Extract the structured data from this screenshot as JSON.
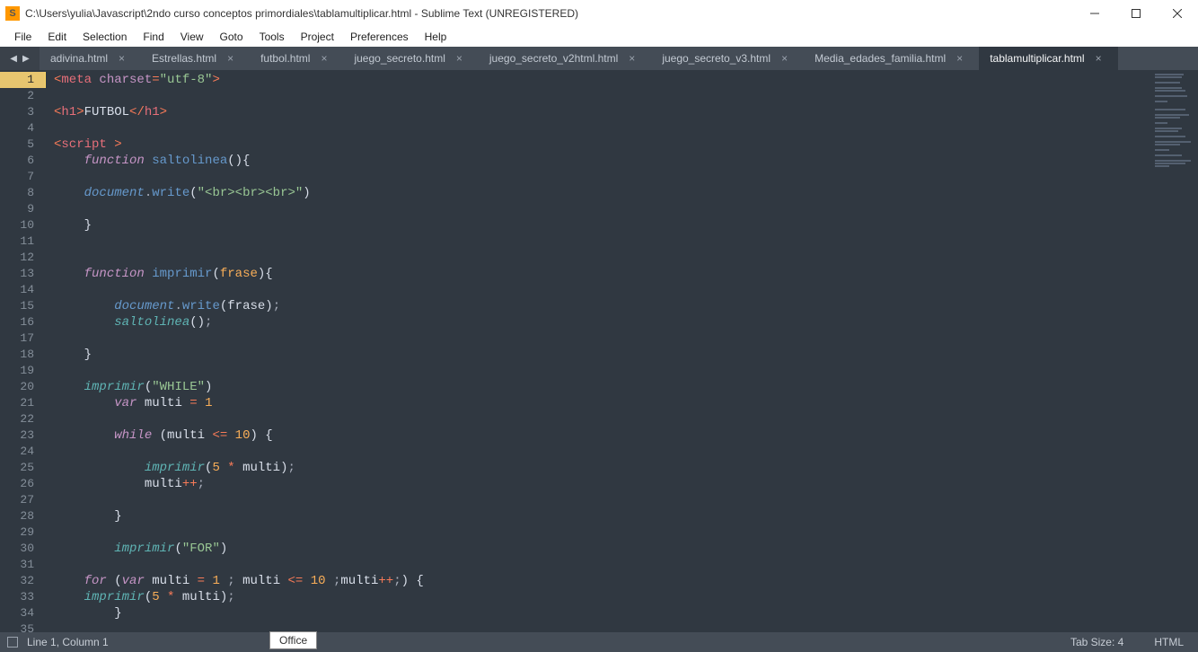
{
  "window": {
    "title": "C:\\Users\\yulia\\Javascript\\2ndo curso conceptos primordiales\\tablamultiplicar.html - Sublime Text (UNREGISTERED)",
    "logo": "S"
  },
  "menu": [
    "File",
    "Edit",
    "Selection",
    "Find",
    "View",
    "Goto",
    "Tools",
    "Project",
    "Preferences",
    "Help"
  ],
  "tabs": [
    {
      "label": "adivina.html",
      "active": false
    },
    {
      "label": "Estrellas.html",
      "active": false
    },
    {
      "label": "futbol.html",
      "active": false
    },
    {
      "label": "juego_secreto.html",
      "active": false
    },
    {
      "label": "juego_secreto_v2html.html",
      "active": false
    },
    {
      "label": "juego_secreto_v3.html",
      "active": false
    },
    {
      "label": "Media_edades_familia.html",
      "active": false
    },
    {
      "label": "tablamultiplicar.html",
      "active": true
    }
  ],
  "status": {
    "cursor": "Line 1, Column 1",
    "chip": "Office",
    "tabsize": "Tab Size: 4",
    "syntax": "HTML"
  },
  "editor": {
    "line_count": 35,
    "current_line": 1
  },
  "code_lines": [
    {
      "tokens": [
        [
          "<",
          "c-op"
        ],
        [
          "meta",
          "c-tag"
        ],
        [
          " ",
          "c-text"
        ],
        [
          "charset",
          "c-attr"
        ],
        [
          "=",
          "c-op"
        ],
        [
          "\"utf-8\"",
          "c-str"
        ],
        [
          ">",
          "c-op"
        ]
      ]
    },
    {
      "tokens": []
    },
    {
      "tokens": [
        [
          "<",
          "c-op"
        ],
        [
          "h1",
          "c-tag"
        ],
        [
          ">",
          "c-op"
        ],
        [
          "FUTBOL",
          "c-text"
        ],
        [
          "</",
          "c-op"
        ],
        [
          "h1",
          "c-tag"
        ],
        [
          ">",
          "c-op"
        ]
      ]
    },
    {
      "tokens": []
    },
    {
      "tokens": [
        [
          "<",
          "c-op"
        ],
        [
          "script",
          "c-tag"
        ],
        [
          " >",
          "c-op"
        ]
      ]
    },
    {
      "tokens": [
        [
          "    ",
          "c-text"
        ],
        [
          "function",
          "c-kw"
        ],
        [
          " ",
          "c-text"
        ],
        [
          "saltolinea",
          "c-fn"
        ],
        [
          "(){",
          "c-text"
        ]
      ]
    },
    {
      "tokens": []
    },
    {
      "tokens": [
        [
          "    ",
          "c-text"
        ],
        [
          "document",
          "c-obj"
        ],
        [
          ".",
          "c-punc"
        ],
        [
          "write",
          "c-fn"
        ],
        [
          "(",
          "c-text"
        ],
        [
          "\"<br><br><br>\"",
          "c-str"
        ],
        [
          ")",
          "c-text"
        ]
      ]
    },
    {
      "tokens": []
    },
    {
      "tokens": [
        [
          "    }",
          "c-text"
        ]
      ]
    },
    {
      "tokens": []
    },
    {
      "tokens": []
    },
    {
      "tokens": [
        [
          "    ",
          "c-text"
        ],
        [
          "function",
          "c-kw"
        ],
        [
          " ",
          "c-text"
        ],
        [
          "imprimir",
          "c-fn"
        ],
        [
          "(",
          "c-text"
        ],
        [
          "frase",
          "c-param"
        ],
        [
          "){",
          "c-text"
        ]
      ]
    },
    {
      "tokens": []
    },
    {
      "tokens": [
        [
          "        ",
          "c-text"
        ],
        [
          "document",
          "c-obj"
        ],
        [
          ".",
          "c-punc"
        ],
        [
          "write",
          "c-fn"
        ],
        [
          "(",
          "c-text"
        ],
        [
          "frase",
          "c-var"
        ],
        [
          ")",
          "c-text"
        ],
        [
          ";",
          "c-punc"
        ]
      ]
    },
    {
      "tokens": [
        [
          "        ",
          "c-text"
        ],
        [
          "saltolinea",
          "c-fn-i"
        ],
        [
          "()",
          "c-text"
        ],
        [
          ";",
          "c-punc"
        ]
      ]
    },
    {
      "tokens": []
    },
    {
      "tokens": [
        [
          "    }",
          "c-text"
        ]
      ]
    },
    {
      "tokens": []
    },
    {
      "tokens": [
        [
          "    ",
          "c-text"
        ],
        [
          "imprimir",
          "c-fn-i"
        ],
        [
          "(",
          "c-text"
        ],
        [
          "\"WHILE\"",
          "c-str"
        ],
        [
          ")",
          "c-text"
        ]
      ]
    },
    {
      "tokens": [
        [
          "        ",
          "c-text"
        ],
        [
          "var",
          "c-kw"
        ],
        [
          " multi ",
          "c-text"
        ],
        [
          "=",
          "c-op"
        ],
        [
          " ",
          "c-text"
        ],
        [
          "1",
          "c-num"
        ]
      ]
    },
    {
      "tokens": []
    },
    {
      "tokens": [
        [
          "        ",
          "c-text"
        ],
        [
          "while",
          "c-kw"
        ],
        [
          " (multi ",
          "c-text"
        ],
        [
          "<=",
          "c-op"
        ],
        [
          " ",
          "c-text"
        ],
        [
          "10",
          "c-num"
        ],
        [
          ") {",
          "c-text"
        ]
      ]
    },
    {
      "tokens": []
    },
    {
      "tokens": [
        [
          "            ",
          "c-text"
        ],
        [
          "imprimir",
          "c-fn-i"
        ],
        [
          "(",
          "c-text"
        ],
        [
          "5",
          "c-num"
        ],
        [
          " ",
          "c-text"
        ],
        [
          "*",
          "c-op"
        ],
        [
          " multi)",
          "c-text"
        ],
        [
          ";",
          "c-punc"
        ]
      ]
    },
    {
      "tokens": [
        [
          "            multi",
          "c-text"
        ],
        [
          "++",
          "c-op"
        ],
        [
          ";",
          "c-punc"
        ]
      ]
    },
    {
      "tokens": []
    },
    {
      "tokens": [
        [
          "        }",
          "c-text"
        ]
      ]
    },
    {
      "tokens": []
    },
    {
      "tokens": [
        [
          "        ",
          "c-text"
        ],
        [
          "imprimir",
          "c-fn-i"
        ],
        [
          "(",
          "c-text"
        ],
        [
          "\"FOR\"",
          "c-str"
        ],
        [
          ")",
          "c-text"
        ]
      ]
    },
    {
      "tokens": []
    },
    {
      "tokens": [
        [
          "    ",
          "c-text"
        ],
        [
          "for",
          "c-kw"
        ],
        [
          " (",
          "c-text"
        ],
        [
          "var",
          "c-kw"
        ],
        [
          " multi ",
          "c-text"
        ],
        [
          "=",
          "c-op"
        ],
        [
          " ",
          "c-text"
        ],
        [
          "1",
          "c-num"
        ],
        [
          " ",
          "c-text"
        ],
        [
          ";",
          "c-punc"
        ],
        [
          " multi ",
          "c-text"
        ],
        [
          "<=",
          "c-op"
        ],
        [
          " ",
          "c-text"
        ],
        [
          "10",
          "c-num"
        ],
        [
          " ",
          "c-text"
        ],
        [
          ";",
          "c-punc"
        ],
        [
          "multi",
          "c-text"
        ],
        [
          "++",
          "c-op"
        ],
        [
          ";",
          "c-punc"
        ],
        [
          ") {",
          "c-text"
        ]
      ]
    },
    {
      "tokens": [
        [
          "    ",
          "c-text"
        ],
        [
          "imprimir",
          "c-fn-i"
        ],
        [
          "(",
          "c-text"
        ],
        [
          "5",
          "c-num"
        ],
        [
          " ",
          "c-text"
        ],
        [
          "*",
          "c-op"
        ],
        [
          " multi)",
          "c-text"
        ],
        [
          ";",
          "c-punc"
        ]
      ]
    },
    {
      "tokens": [
        [
          "        }",
          "c-text"
        ]
      ]
    },
    {
      "tokens": []
    }
  ]
}
